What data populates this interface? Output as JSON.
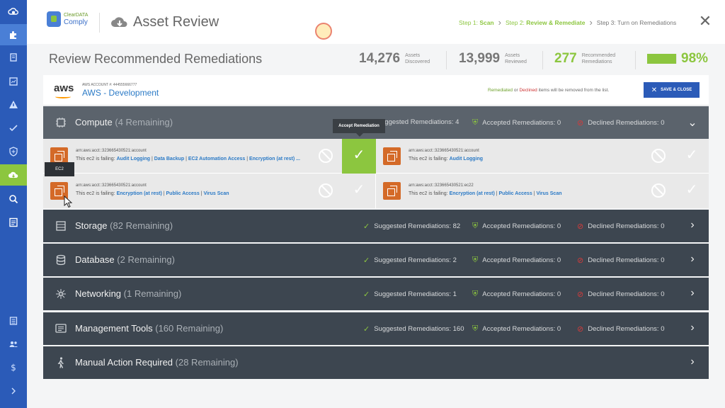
{
  "brand": {
    "line1": "ClearDATA",
    "line2": "Comply"
  },
  "app_title": "Asset Review",
  "steps": [
    {
      "prefix": "Step 1: ",
      "name": "Scan"
    },
    {
      "prefix": "Step 2: ",
      "name": "Review & Remediate"
    },
    {
      "prefix": "Step 3: ",
      "name": "Turn on Remediations"
    }
  ],
  "page_title": "Review Recommended Remediations",
  "stats": {
    "discovered": {
      "num": "14,276",
      "l1": "Assets",
      "l2": "Discovered"
    },
    "reviewed": {
      "num": "13,999",
      "l1": "Assets",
      "l2": "Reviewed"
    },
    "recommended": {
      "num": "277",
      "l1": "Recommended",
      "l2": "Remediations"
    },
    "progress_fraction": 0.98,
    "percent": "98%"
  },
  "account": {
    "label": "AWS ACCOUNT #: 444555666777",
    "name": "AWS - Development",
    "logo": "aws",
    "note_remediated": "Remediated",
    "note_or": " or ",
    "note_declined": "Declined",
    "note_rest": " items will be removed from the list.",
    "save_label": "SAVE & CLOSE"
  },
  "tooltip_accept": "Accept Remediation",
  "tooltip_ec2": "EC2",
  "categories": [
    {
      "name": "Compute",
      "remaining": "(4 Remaining)",
      "suggested": "uggested Remediations: 4",
      "accepted": "Accepted Remediations: 0",
      "declined": "Declined Remediations: 0"
    },
    {
      "name": "Storage",
      "remaining": "(82 Remaining)",
      "suggested": "Suggested Remediations: 82",
      "accepted": "Accepted Remediations: 0",
      "declined": "Declined Remediations: 0"
    },
    {
      "name": "Database",
      "remaining": "(2 Remaining)",
      "suggested": "Suggested Remediations: 2",
      "accepted": "Accepted Remediations: 0",
      "declined": "Declined Remediations: 0"
    },
    {
      "name": "Networking",
      "remaining": "(1 Remaining)",
      "suggested": "Suggested Remediations: 1",
      "accepted": "Accepted Remediations: 0",
      "declined": "Declined Remediations: 0"
    },
    {
      "name": "Management Tools",
      "remaining": "(160 Remaining)",
      "suggested": "Suggested Remediations: 160",
      "accepted": "Accepted Remediations: 0",
      "declined": "Declined Remediations: 0"
    },
    {
      "name": "Manual Action Required",
      "remaining": "(28 Remaining)"
    }
  ],
  "resources": [
    {
      "arn": "arn:aws:acct::323665430521:account",
      "fail_prefix": "This ec2 is failing: ",
      "links": [
        "Audit Logging",
        "Data Backup",
        "EC2 Automation Access",
        "Encryption (at rest) ..."
      ]
    },
    {
      "arn": "arn:aws:acct::323665430521:account",
      "fail_prefix": "This ec2 is failing: ",
      "links": [
        "Audit Logging"
      ]
    },
    {
      "arn": "arn:aws:acct::323665430521:account",
      "fail_prefix": "This ec2 is failing: ",
      "links": [
        "Encryption (at rest)",
        "Public Access",
        "Virus Scan"
      ]
    },
    {
      "arn": "arn:aws:acct::323665430521:ec22",
      "fail_prefix": "This ec2 is failing: ",
      "links": [
        "Encryption (at rest)",
        "Public Access",
        "Virus Scan"
      ]
    }
  ],
  "colors": {
    "sidebar": "#2b5bb8",
    "accent": "#8cc63f",
    "panel": "#3d4650",
    "link": "#2b7ac6",
    "resource_icon": "#d46a28"
  }
}
